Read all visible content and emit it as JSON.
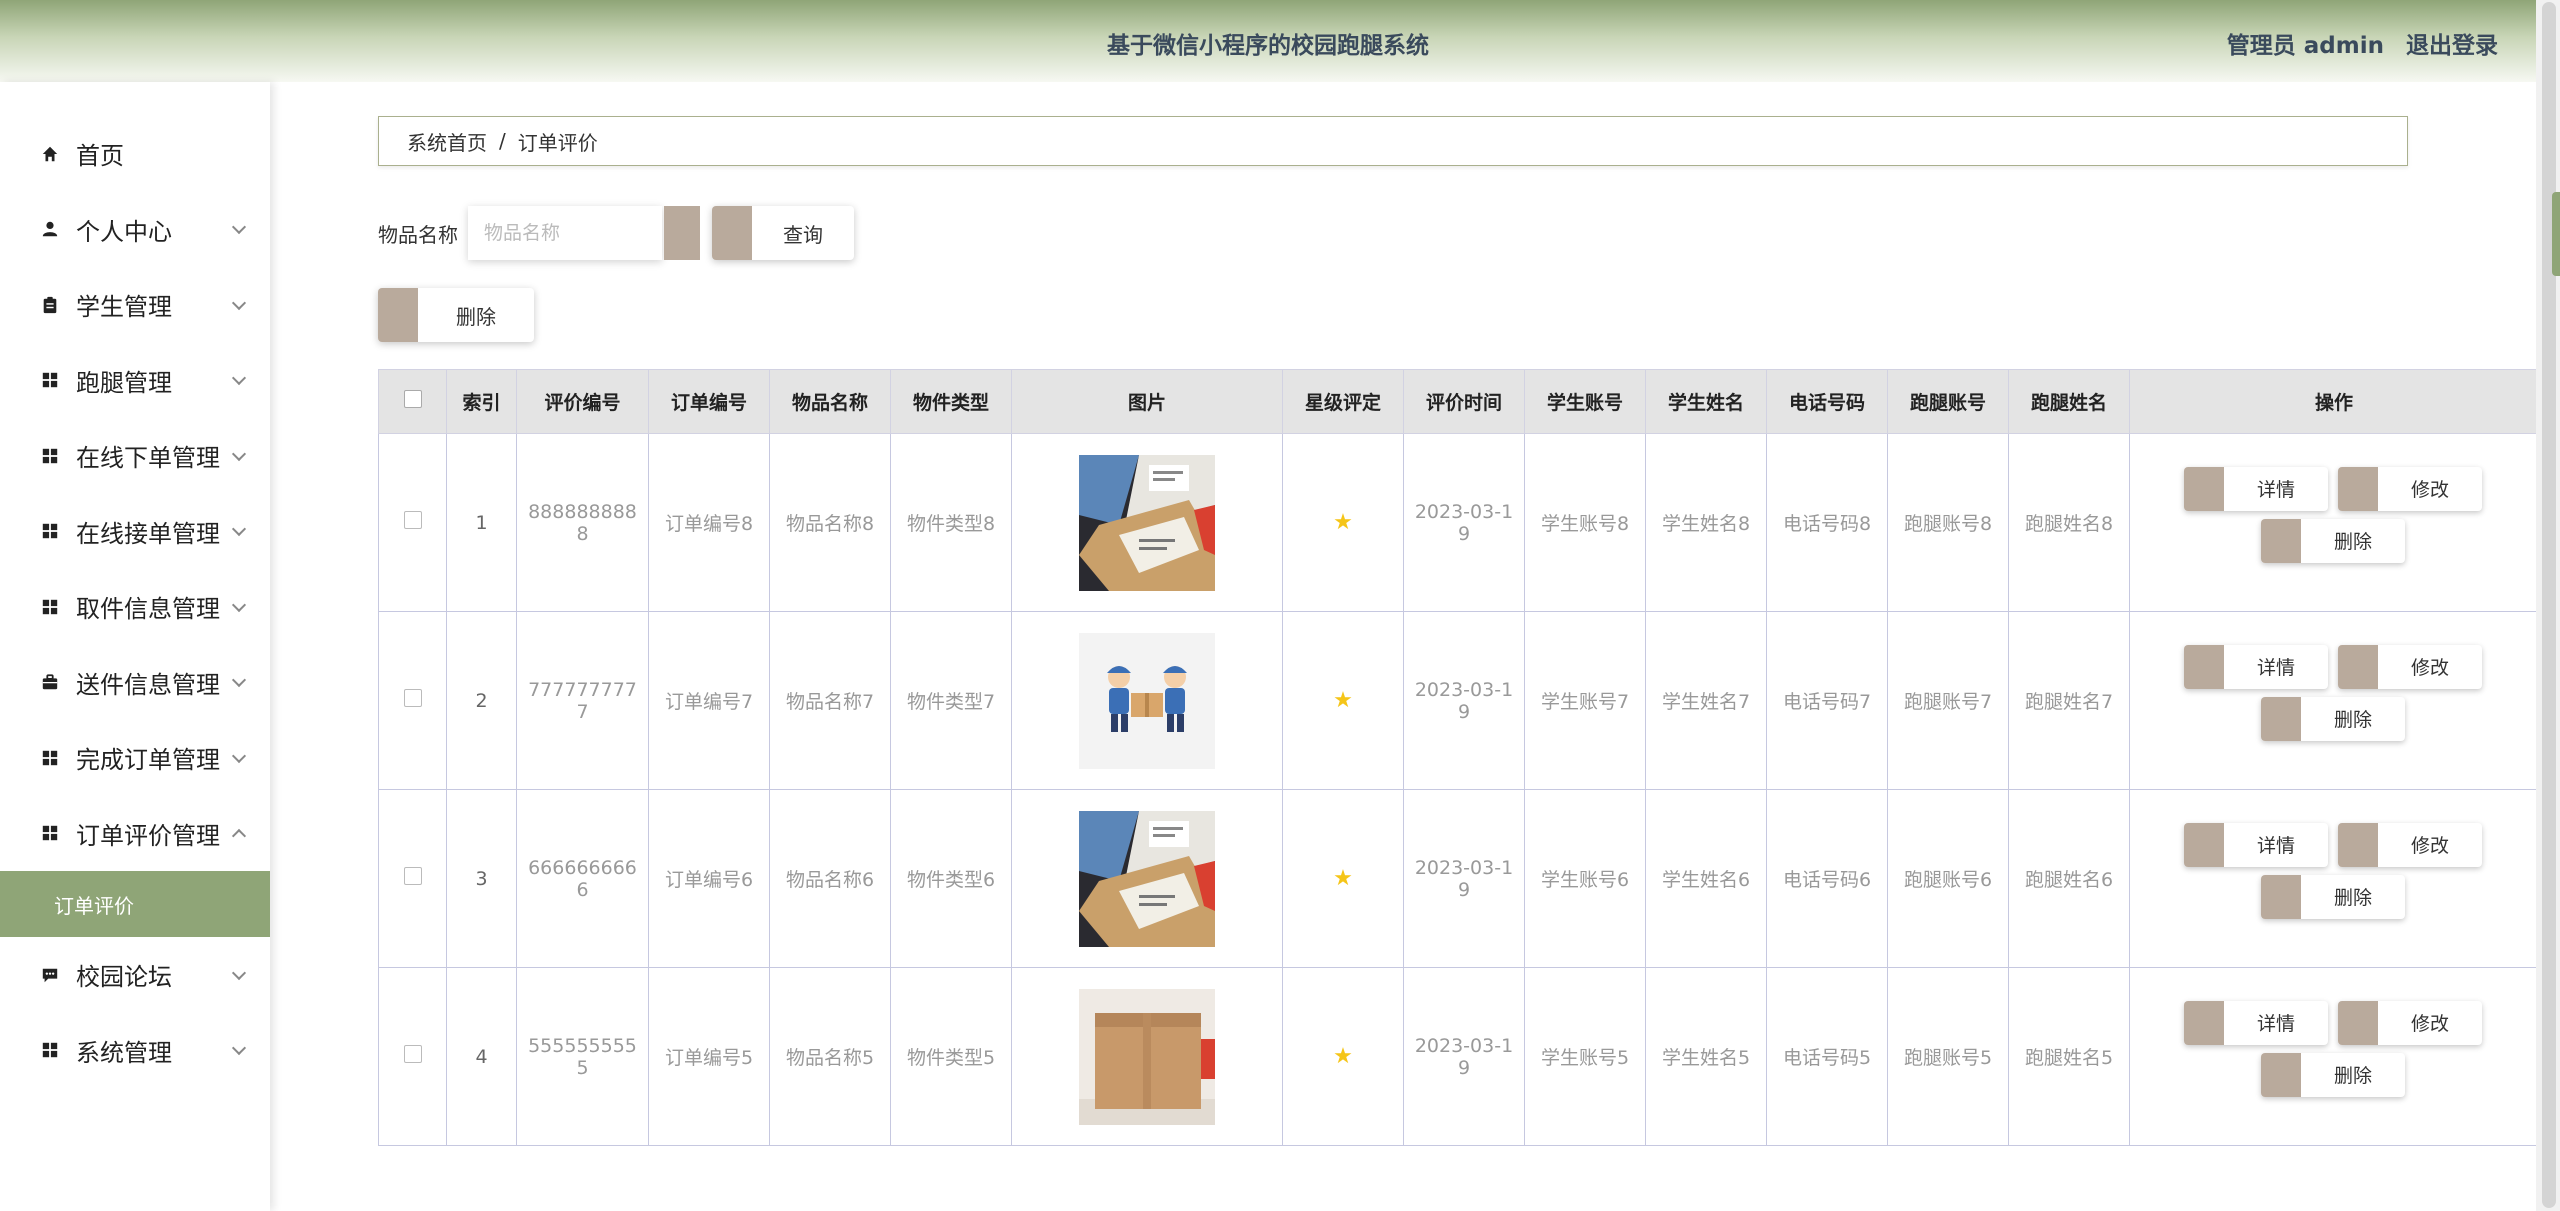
{
  "header": {
    "title": "基于微信小程序的校园跑腿系统",
    "user_label": "管理员 admin",
    "logout": "退出登录"
  },
  "sidebar": {
    "items": [
      {
        "label": "首页",
        "icon": "home-icon"
      },
      {
        "label": "个人中心",
        "icon": "user-icon"
      },
      {
        "label": "学生管理",
        "icon": "clipboard-icon"
      },
      {
        "label": "跑腿管理",
        "icon": "grid-icon"
      },
      {
        "label": "在线下单管理",
        "icon": "grid-icon"
      },
      {
        "label": "在线接单管理",
        "icon": "grid-icon"
      },
      {
        "label": "取件信息管理",
        "icon": "grid-icon"
      },
      {
        "label": "送件信息管理",
        "icon": "briefcase-icon"
      },
      {
        "label": "完成订单管理",
        "icon": "grid-icon"
      },
      {
        "label": "订单评价管理",
        "icon": "grid-icon"
      },
      {
        "label": "校园论坛",
        "icon": "chat-icon"
      },
      {
        "label": "系统管理",
        "icon": "grid-icon"
      }
    ],
    "submenu": {
      "label": "订单评价"
    }
  },
  "breadcrumb": {
    "home": "系统首页",
    "separator": "/",
    "current": "订单评价"
  },
  "search": {
    "label": "物品名称",
    "placeholder": "物品名称",
    "query_button": "查询"
  },
  "toolbar": {
    "delete_label": "删除"
  },
  "table": {
    "columns": [
      "索引",
      "评价编号",
      "订单编号",
      "物品名称",
      "物件类型",
      "图片",
      "星级评定",
      "评价时间",
      "学生账号",
      "学生姓名",
      "电话号码",
      "跑腿账号",
      "跑腿姓名",
      "操作"
    ],
    "rows": [
      {
        "index": "1",
        "review_no": "8888888888",
        "order_no": "订单编号8",
        "item_name": "物品名称8",
        "item_type": "物件类型8",
        "image": "parcels-photo",
        "rating": "★",
        "time": "2023-03-19",
        "student_account": "学生账号8",
        "student_name": "学生姓名8",
        "phone": "电话号码8",
        "runner_account": "跑腿账号8",
        "runner_name": "跑腿姓名8"
      },
      {
        "index": "2",
        "review_no": "7777777777",
        "order_no": "订单编号7",
        "item_name": "物品名称7",
        "item_type": "物件类型7",
        "image": "couriers-illustration",
        "rating": "★",
        "time": "2023-03-19",
        "student_account": "学生账号7",
        "student_name": "学生姓名7",
        "phone": "电话号码7",
        "runner_account": "跑腿账号7",
        "runner_name": "跑腿姓名7"
      },
      {
        "index": "3",
        "review_no": "6666666666",
        "order_no": "订单编号6",
        "item_name": "物品名称6",
        "item_type": "物件类型6",
        "image": "parcels-photo",
        "rating": "★",
        "time": "2023-03-19",
        "student_account": "学生账号6",
        "student_name": "学生姓名6",
        "phone": "电话号码6",
        "runner_account": "跑腿账号6",
        "runner_name": "跑腿姓名6"
      },
      {
        "index": "4",
        "review_no": "5555555555",
        "order_no": "订单编号5",
        "item_name": "物品名称5",
        "item_type": "物件类型5",
        "image": "cardboard-box-photo",
        "rating": "★",
        "time": "2023-03-19",
        "student_account": "学生账号5",
        "student_name": "学生姓名5",
        "phone": "电话号码5",
        "runner_account": "跑腿账号5",
        "runner_name": "跑腿姓名5"
      }
    ],
    "actions": {
      "detail": "详情",
      "edit": "修改",
      "delete": "删除"
    }
  },
  "colors": {
    "accent": "#8fa577",
    "button_block": "#b9aa9c",
    "star": "#f5c518"
  }
}
